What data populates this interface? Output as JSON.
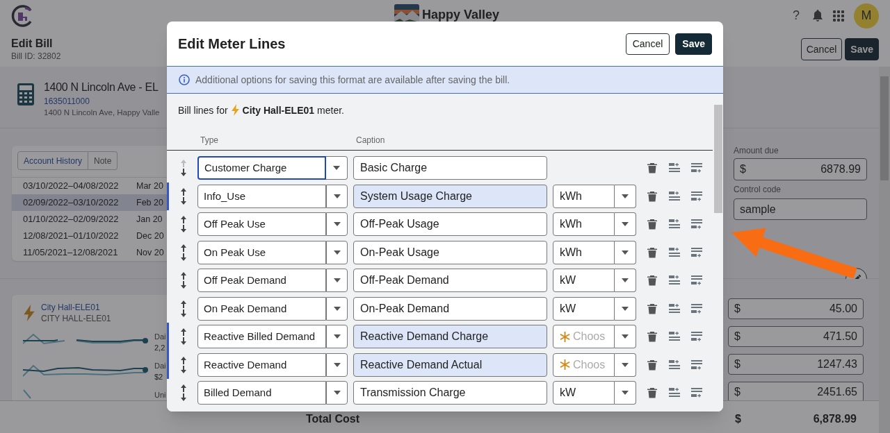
{
  "app_bar": {
    "brand": "Happy Valley",
    "help": "?",
    "avatar": "M"
  },
  "page": {
    "title": "Edit Bill",
    "subtitle": "Bill ID: 32802",
    "buttons": [
      {
        "label": "Cancel",
        "kind": "secondary"
      },
      {
        "label": "Save",
        "kind": "primary"
      }
    ]
  },
  "account": {
    "name": "1400 N Lincoln Ave - EL",
    "number": "1635011000",
    "address": "1400 N Lincoln Ave, Happy Valle"
  },
  "history": {
    "tabs": [
      {
        "label": "Account History",
        "selected": true
      },
      {
        "label": "Note",
        "selected": false
      }
    ],
    "rows": [
      {
        "period": "03/10/2022–04/08/2022",
        "month": "Mar 20",
        "selected": false
      },
      {
        "period": "02/09/2022–03/10/2022",
        "month": "Feb 20",
        "selected": true
      },
      {
        "period": "01/10/2022–02/09/2022",
        "month": "Jan 20",
        "selected": false
      },
      {
        "period": "12/08/2021–01/10/2022",
        "month": "Dec 20",
        "selected": false
      },
      {
        "period": "11/05/2021–12/08/2021",
        "month": "Nov 20",
        "selected": false
      }
    ]
  },
  "amount_due": {
    "label": "Amount due",
    "currency": "$",
    "value": "6878.99"
  },
  "control_code": {
    "label": "Control code",
    "value": "sample"
  },
  "meter": {
    "name": "City Hall-ELE01",
    "code": "CITY HALL-ELE01",
    "stats": [
      {
        "label": "Dai",
        "value": "2,2"
      },
      {
        "label": "Dai",
        "value": "$2"
      },
      {
        "label": "Uni"
      }
    ]
  },
  "line_amounts": [
    {
      "currency": "$",
      "value": "45.00"
    },
    {
      "currency": "$",
      "value": "471.50"
    },
    {
      "currency": "$",
      "value": "1247.43"
    },
    {
      "currency": "$",
      "value": "2451.65"
    }
  ],
  "total": {
    "label": "Total Cost",
    "currency": "$",
    "value": "6,878.99"
  },
  "dialog": {
    "title": "Edit Meter Lines",
    "buttons": [
      {
        "label": "Cancel",
        "kind": "secondary"
      },
      {
        "label": "Save",
        "kind": "primary"
      }
    ],
    "notice": "Additional options for saving this format are available after saving the bill.",
    "intro": "Bill lines for",
    "meter": "City Hall-ELE01",
    "intro_end": "meter.",
    "columns": [
      "Type",
      "Caption"
    ],
    "lines": [
      {
        "type": "Customer Charge",
        "caption": "Basic Charge",
        "highlighted": false,
        "focused": true,
        "can_move_up": false
      },
      {
        "type": "Info_Use",
        "caption": "System Usage Charge",
        "unit": {
          "value": "kWh"
        },
        "highlighted": true,
        "focused": false,
        "can_move_up": true
      },
      {
        "type": "Off Peak Use",
        "caption": "Off-Peak Usage",
        "unit": {
          "value": "kWh"
        },
        "highlighted": false,
        "focused": false,
        "can_move_up": true
      },
      {
        "type": "On Peak Use",
        "caption": "On-Peak Usage",
        "unit": {
          "value": "kWh"
        },
        "highlighted": false,
        "focused": false,
        "can_move_up": true
      },
      {
        "type": "Off Peak Demand",
        "caption": "Off-Peak Demand",
        "unit": {
          "value": "kW"
        },
        "highlighted": false,
        "focused": false,
        "can_move_up": true
      },
      {
        "type": "On Peak Demand",
        "caption": "On-Peak Demand",
        "unit": {
          "value": "kW"
        },
        "highlighted": false,
        "focused": false,
        "can_move_up": true
      },
      {
        "type": "Reactive Billed Demand",
        "caption": "Reactive Demand Charge",
        "unit": {
          "placeholder": "Choos",
          "required": true
        },
        "highlighted": true,
        "focused": false,
        "can_move_up": true
      },
      {
        "type": "Reactive Demand",
        "caption": "Reactive Demand Actual",
        "unit": {
          "placeholder": "Choos",
          "required": true
        },
        "highlighted": true,
        "focused": false,
        "can_move_up": true
      },
      {
        "type": "Billed Demand",
        "caption": "Transmission Charge",
        "unit": {
          "value": "kW"
        },
        "highlighted": false,
        "focused": false,
        "can_move_up": true
      }
    ]
  }
}
